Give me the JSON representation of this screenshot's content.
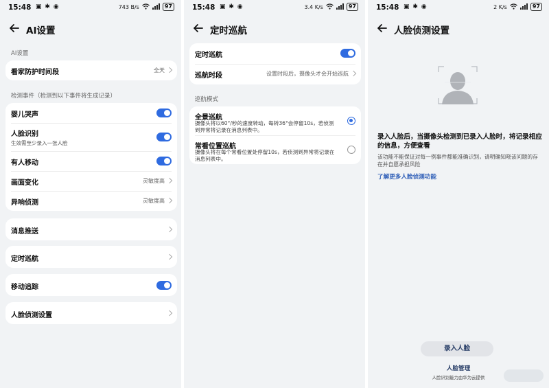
{
  "status": {
    "time": "15:48",
    "battery": "97",
    "net_speed_1": "743 B/s",
    "net_speed_2": "3.4 K/s",
    "net_speed_3": "2 K/s"
  },
  "screen1": {
    "title": "AI设置",
    "section_ai": "AI设置",
    "guard_period": {
      "label": "看家防护时间段",
      "value": "全天"
    },
    "section_events": "检测事件（检测到以下事件将生成记录）",
    "baby_cry": "婴儿哭声",
    "face_recog": {
      "label": "人脸识别",
      "sub": "生效需至少录入一张人脸"
    },
    "person_move": "有人移动",
    "scene_change": {
      "label": "画面变化",
      "value": "灵敏度高"
    },
    "abnormal_sound": {
      "label": "异响侦测",
      "value": "灵敏度高"
    },
    "push": "消息推送",
    "cruise": "定时巡航",
    "tracking": "移动追踪",
    "face_settings": "人脸侦测设置"
  },
  "screen2": {
    "title": "定时巡航",
    "cruise_toggle": "定时巡航",
    "cruise_period": {
      "label": "巡航时段",
      "value": "设置时段后，摄像头才会开始巡航"
    },
    "section_mode": "巡航模式",
    "panorama": {
      "label": "全景巡航",
      "desc": "摄像头将以60°/秒的速度转动，每转36°会停留10s，若侦测到异常将记录在消息列表中。"
    },
    "frequent": {
      "label": "常看位置巡航",
      "desc": "摄像头将在每个常看位置处停留10s，若侦测到异常将记录在消息列表中。"
    }
  },
  "screen3": {
    "title": "人脸侦测设置",
    "intro": "录入人脸后，当摄像头检测到已录入人脸时，将记录相应的信息，方便查看",
    "note": "该功能不能保证对每一例事件都能准确识别，请明确知晓该问题的存在并自愿承担风险",
    "link": "了解更多人脸侦测功能",
    "enroll_button": "录入人脸",
    "manage_button": "人脸管理",
    "footnote": "人脸识别能力由华为云提供"
  },
  "colors": {
    "accent": "#2f6be0",
    "background": "#f1f3f5",
    "card": "#ffffff"
  }
}
